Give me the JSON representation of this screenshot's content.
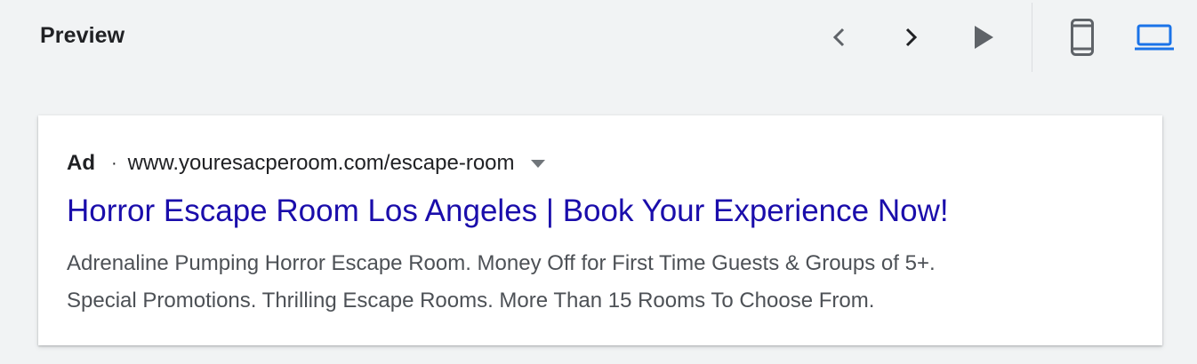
{
  "header": {
    "title": "Preview",
    "controls": {
      "prev": "chevron-left-icon",
      "next": "chevron-right-icon",
      "play": "play-icon",
      "mobile": "smartphone-icon",
      "desktop": "laptop-icon"
    },
    "active_device": "desktop",
    "accent_color": "#1a73e8"
  },
  "ad": {
    "label": "Ad",
    "separator": "·",
    "display_url": "www.youresacperoom.com/escape-room",
    "headline": "Horror Escape Room Los Angeles | Book Your Experience Now!",
    "description_lines": [
      "Adrenaline Pumping Horror Escape Room. Money Off for First Time Guests & Groups of 5+.",
      "Special Promotions. Thrilling Escape Rooms. More Than 15 Rooms To Choose From."
    ],
    "colors": {
      "headline": "#1a0dab",
      "description": "#4d5156"
    }
  }
}
